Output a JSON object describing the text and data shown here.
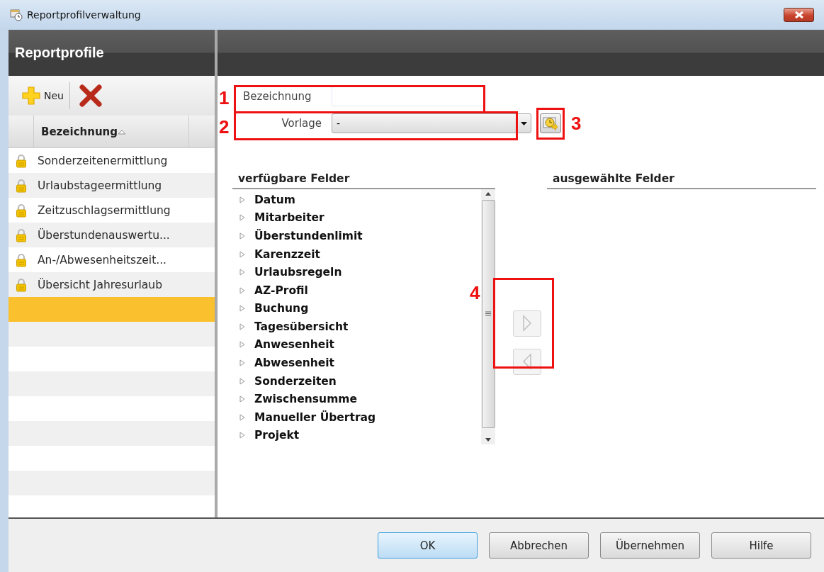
{
  "window": {
    "title": "Reportprofilverwaltung"
  },
  "sidebar": {
    "title": "Reportprofile",
    "toolbar": {
      "new_label": "Neu"
    },
    "column": {
      "label": "Bezeichnung",
      "sorted": true
    },
    "items": [
      {
        "name": "Sonderzeitenermittlung",
        "locked": true,
        "selected": false
      },
      {
        "name": "Urlaubstageermittlung",
        "locked": true,
        "selected": false
      },
      {
        "name": "Zeitzuschlagsermittlung",
        "locked": true,
        "selected": false
      },
      {
        "name": "Überstundenauswertu...",
        "locked": true,
        "selected": false
      },
      {
        "name": "An-/Abwesenheitszeit...",
        "locked": true,
        "selected": false
      },
      {
        "name": "Übersicht Jahresurlaub",
        "locked": true,
        "selected": false
      }
    ],
    "new_entry": {
      "selected": true
    }
  },
  "form": {
    "name_label": "Bezeichnung",
    "template_label": "Vorlage",
    "template_value": "-"
  },
  "available": {
    "title": "verfügbare Felder",
    "items": [
      {
        "label": "Datum",
        "expanded": false
      },
      {
        "label": "Mitarbeiter",
        "expanded": false
      },
      {
        "label": "Überstundenlimit",
        "expanded": false
      },
      {
        "label": "Karenzzeit",
        "expanded": false
      },
      {
        "label": "Urlaubsregeln",
        "expanded": false
      },
      {
        "label": "AZ-Profil",
        "expanded": false
      },
      {
        "label": "Buchung",
        "expanded": false
      },
      {
        "label": "Tagesübersicht",
        "expanded": false
      },
      {
        "label": "Anwesenheit",
        "expanded": false
      },
      {
        "label": "Abwesenheit",
        "expanded": false
      },
      {
        "label": "Sonderzeiten",
        "expanded": false
      },
      {
        "label": "Zwischensumme",
        "expanded": false
      },
      {
        "label": "Manueller Übertrag",
        "expanded": false
      },
      {
        "label": "Projekt",
        "expanded": false
      }
    ]
  },
  "selected_fields": {
    "title": "ausgewählte Felder"
  },
  "move_buttons": {
    "add_disabled": true,
    "remove_disabled": true
  },
  "callouts": [
    {
      "label": "1"
    },
    {
      "label": "2"
    },
    {
      "label": "3"
    },
    {
      "label": "4"
    }
  ],
  "buttons": [
    {
      "label": "OK",
      "default": true
    },
    {
      "label": "Abbrechen",
      "default": false
    },
    {
      "label": "Übernehmen",
      "default": false
    },
    {
      "label": "Hilfe",
      "default": false
    }
  ]
}
